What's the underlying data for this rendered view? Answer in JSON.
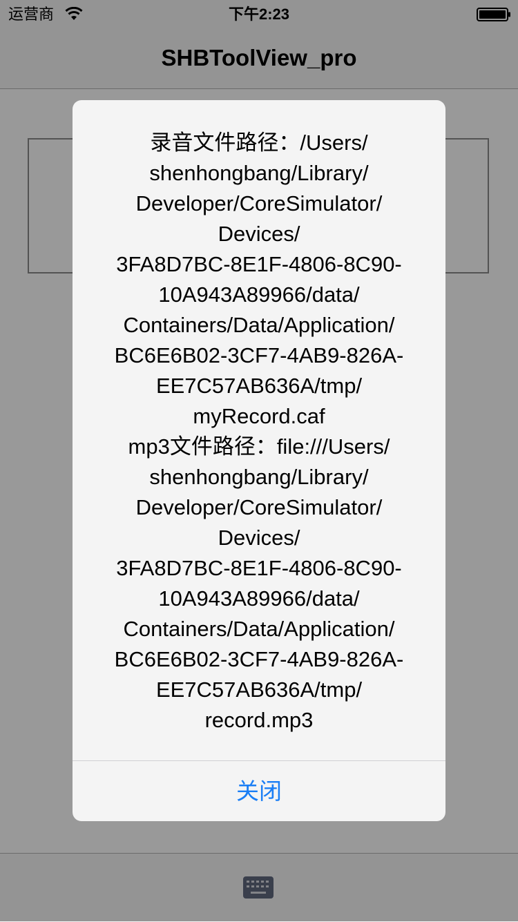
{
  "status_bar": {
    "carrier": "运营商",
    "time": "下午2:23"
  },
  "nav": {
    "title": "SHBToolView_pro"
  },
  "alert": {
    "message_lines": [
      "录音文件路径：/Users/",
      "shenhongbang/Library/",
      "Developer/CoreSimulator/",
      "Devices/",
      "3FA8D7BC-8E1F-4806-8C90-",
      "10A943A89966/data/",
      "Containers/Data/Application/",
      "BC6E6B02-3CF7-4AB9-826A-",
      "EE7C57AB636A/tmp/",
      "myRecord.caf",
      "mp3文件路径：file:///Users/",
      "shenhongbang/Library/",
      "Developer/CoreSimulator/",
      "Devices/",
      "3FA8D7BC-8E1F-4806-8C90-",
      "10A943A89966/data/",
      "Containers/Data/Application/",
      "BC6E6B02-3CF7-4AB9-826A-",
      "EE7C57AB636A/tmp/",
      "record.mp3"
    ],
    "button_label": "关闭"
  },
  "icons": {
    "wifi": "wifi-icon",
    "battery": "battery-icon",
    "keyboard": "keyboard-icon"
  },
  "colors": {
    "accent": "#1a7ef5",
    "keyboard_button": "#62697f"
  }
}
